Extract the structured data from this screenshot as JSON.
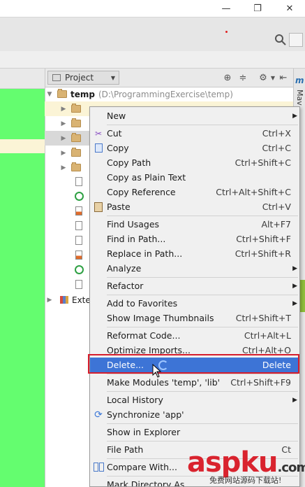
{
  "window": {
    "minimize": "—",
    "restore": "❐",
    "close": "✕"
  },
  "panel": {
    "tab_label": "Project",
    "side_label": "Mav"
  },
  "tree": {
    "root_name": "temp",
    "root_path": "(D:\\ProgrammingExercise\\temp)",
    "external": "Exte"
  },
  "menu": {
    "items": [
      {
        "label": "New",
        "shortcut": "",
        "submenu": true
      },
      {
        "label": "Cut",
        "shortcut": "Ctrl+X"
      },
      {
        "label": "Copy",
        "shortcut": "Ctrl+C"
      },
      {
        "label": "Copy Path",
        "shortcut": "Ctrl+Shift+C"
      },
      {
        "label": "Copy as Plain Text",
        "shortcut": ""
      },
      {
        "label": "Copy Reference",
        "shortcut": "Ctrl+Alt+Shift+C"
      },
      {
        "label": "Paste",
        "shortcut": "Ctrl+V"
      },
      {
        "label": "Find Usages",
        "shortcut": "Alt+F7"
      },
      {
        "label": "Find in Path...",
        "shortcut": "Ctrl+Shift+F"
      },
      {
        "label": "Replace in Path...",
        "shortcut": "Ctrl+Shift+R"
      },
      {
        "label": "Analyze",
        "shortcut": "",
        "submenu": true
      },
      {
        "label": "Refactor",
        "shortcut": "",
        "submenu": true
      },
      {
        "label": "Add to Favorites",
        "shortcut": "",
        "submenu": true
      },
      {
        "label": "Show Image Thumbnails",
        "shortcut": "Ctrl+Shift+T"
      },
      {
        "label": "Reformat Code...",
        "shortcut": "Ctrl+Alt+L"
      },
      {
        "label": "Optimize Imports...",
        "shortcut": "Ctrl+Alt+O"
      },
      {
        "label": "Delete...",
        "shortcut": "Delete"
      },
      {
        "label": "Make Modules 'temp', 'lib'",
        "shortcut": "Ctrl+Shift+F9"
      },
      {
        "label": "Local History",
        "shortcut": "",
        "submenu": true
      },
      {
        "label": "Synchronize 'app'",
        "shortcut": ""
      },
      {
        "label": "Show in Explorer",
        "shortcut": ""
      },
      {
        "label": "File Path",
        "shortcut": "Ct"
      },
      {
        "label": "Compare With...",
        "shortcut": ""
      },
      {
        "label": "Mark Directory As",
        "shortcut": ""
      }
    ]
  },
  "watermark": {
    "text": "aspku",
    "suffix": ".com",
    "sub": "免费网站源码下载站!"
  },
  "colors": {
    "editor": "#64fd6f",
    "highlight": "#3d74d6",
    "outline": "#d61d2c"
  }
}
